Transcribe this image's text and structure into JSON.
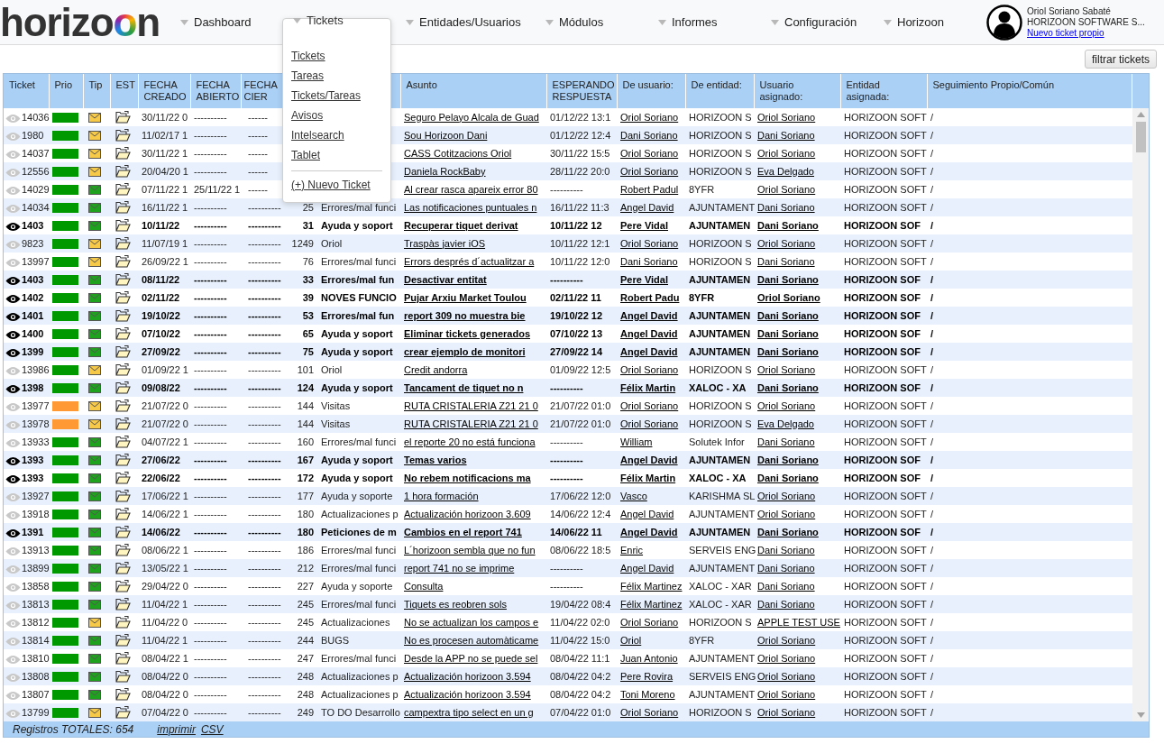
{
  "logo": {
    "text": "horizoon"
  },
  "nav": [
    {
      "label": "Dashboard",
      "expanded": false
    },
    {
      "label": "Tickets",
      "expanded": true
    },
    {
      "label": "Entidades/Usuarios",
      "expanded": false
    },
    {
      "label": "Módulos",
      "expanded": false
    },
    {
      "label": "Informes",
      "expanded": false
    },
    {
      "label": "Configuración",
      "expanded": false
    },
    {
      "label": "Horizoon",
      "expanded": false
    }
  ],
  "dropdown": {
    "items": [
      "Tickets",
      "Tareas",
      "Tickets/Tareas",
      "Avisos",
      "Intelsearch",
      "Tablet"
    ],
    "action": "(+) Nuevo Ticket"
  },
  "user": {
    "name": "Oriol Soriano Sabaté",
    "company": "HORIZOON SOFTWARE S...",
    "link": "Nuevo ticket propio"
  },
  "filter_button": "filtrar tickets",
  "table": {
    "columns": [
      "Ticket",
      "Prio",
      "Tip",
      "EST",
      "FECHA\nCREADO",
      "FECHA\nABIERTO",
      "FECHA\nCIER",
      "Asunto",
      "ESPERANDO\nRESPUESTA",
      "De usuario:",
      "De entidad:",
      "Usuario\nasignado:",
      "Entidad\nasignada:",
      "Seguimiento Propio/Común"
    ],
    "rows": [
      {
        "ticket": "14036",
        "unread": false,
        "priority": {
          "color": "#009900"
        },
        "type": {
          "color": "#f7c948"
        },
        "created": "30/11/22 0",
        "opened": "----------",
        "closed": "------",
        "subject": "Seguro Pelayo Alcala de Guad",
        "waiting": "01/12/22 13:1",
        "user": "Oriol Soriano",
        "entity": "HORIZOON S",
        "assigned_user": "Oriol Soriano",
        "assigned_entity": "HORIZOON SOFT",
        "follow": "/"
      },
      {
        "ticket": "1980",
        "unread": false,
        "priority": {
          "color": "#009900"
        },
        "type": {
          "color": "#f7c948"
        },
        "created": "11/02/17 1",
        "opened": "----------",
        "closed": "------",
        "subject": "Sou Horizoon Dani",
        "waiting": "01/12/22 12:4",
        "user": "Dani Soriano",
        "entity": "HORIZOON S",
        "assigned_user": "Dani Soriano",
        "assigned_entity": "HORIZOON SOFT",
        "follow": "/"
      },
      {
        "ticket": "14037",
        "unread": false,
        "priority": {
          "color": "#009900"
        },
        "type": {
          "color": "#f7c948"
        },
        "created": "30/11/22 1",
        "opened": "----------",
        "closed": "------",
        "subject": "CASS Cotitzacions Oriol",
        "waiting": "30/11/22 15:5",
        "user": "Oriol Soriano",
        "entity": "HORIZOON S",
        "assigned_user": "Oriol Soriano",
        "assigned_entity": "HORIZOON SOFT",
        "follow": "/"
      },
      {
        "ticket": "12556",
        "unread": false,
        "priority": {
          "color": "#009900"
        },
        "type": {
          "color": "#f7c948"
        },
        "created": "20/04/20 1",
        "opened": "----------",
        "closed": "------",
        "subject": "Daniela RockBaby",
        "waiting": "28/11/22 20:0",
        "user": "Oriol Soriano",
        "entity": "HORIZOON S",
        "assigned_user": "Eva Delgado",
        "assigned_entity": "HORIZOON SOFT",
        "follow": "/"
      },
      {
        "ticket": "14029",
        "unread": false,
        "priority": {
          "color": "#009900"
        },
        "type": {
          "color": "#1fa31f"
        },
        "created": "07/11/22 1",
        "opened": "25/11/22 1",
        "closed": "------",
        "subject": "Al crear rasca apareix error 80",
        "waiting": "----------",
        "user": "Robert Padul",
        "entity": "8YFR",
        "assigned_user": "Oriol Soriano",
        "assigned_entity": "HORIZOON SOFT",
        "follow": "/"
      },
      {
        "ticket": "14034",
        "unread": false,
        "priority": {
          "color": "#009900"
        },
        "type": {
          "color": "#1fa31f"
        },
        "created": "16/11/22 1",
        "opened": "----------",
        "closed": "----------",
        "d": "25",
        "category": "Errores/mal funci",
        "subject": "Las notificaciones puntuales n",
        "waiting": "16/11/22 11:3",
        "user": "Angel David",
        "entity": "AJUNTAMENT",
        "assigned_user": "Dani Soriano",
        "assigned_entity": "HORIZOON SOFT",
        "follow": "/"
      },
      {
        "ticket": "1403",
        "unread": true,
        "priority": {
          "color": "#009900"
        },
        "type": {
          "color": "#1fa31f"
        },
        "created": "10/11/22",
        "opened": "----------",
        "closed": "----------",
        "d": "31",
        "category": "Ayuda y soport",
        "subject": "Recuperar tiquet derivat",
        "waiting": "10/11/22 12",
        "user": "Pere Vidal",
        "entity": "AJUNTAMEN",
        "assigned_user": "Dani Soriano",
        "assigned_entity": "HORIZOON SOF",
        "follow": "/"
      },
      {
        "ticket": "9823",
        "unread": false,
        "priority": {
          "color": "#009900"
        },
        "type": {
          "color": "#f7c948"
        },
        "created": "11/07/19 1",
        "opened": "----------",
        "closed": "----------",
        "d": "1249",
        "category": "Oriol",
        "subject": "Traspàs javier iOS",
        "waiting": "10/11/22 12:1",
        "user": "Oriol Soriano",
        "entity": "HORIZOON S",
        "assigned_user": "Oriol Soriano",
        "assigned_entity": "HORIZOON SOFT",
        "follow": "/"
      },
      {
        "ticket": "13997",
        "unread": false,
        "priority": {
          "color": "#009900"
        },
        "type": {
          "color": "#f7c948"
        },
        "created": "26/09/22 1",
        "opened": "----------",
        "closed": "----------",
        "d": "76",
        "category": "Errores/mal funci",
        "subject": "Errors després d´actualitzar a",
        "waiting": "10/11/22 12:0",
        "user": "Dani Soriano",
        "entity": "HORIZOON S",
        "assigned_user": "Dani Soriano",
        "assigned_entity": "HORIZOON SOFT",
        "follow": "/"
      },
      {
        "ticket": "1403",
        "unread": true,
        "priority": {
          "color": "#009900"
        },
        "type": {
          "color": "#1fa31f"
        },
        "created": "08/11/22",
        "opened": "----------",
        "closed": "----------",
        "d": "33",
        "category": "Errores/mal fun",
        "subject": "Desactivar entitat",
        "waiting": "----------",
        "user": "Pere Vidal",
        "entity": "AJUNTAMEN",
        "assigned_user": "Dani Soriano",
        "assigned_entity": "HORIZOON SOF",
        "follow": "/"
      },
      {
        "ticket": "1402",
        "unread": true,
        "priority": {
          "color": "#009900"
        },
        "type": {
          "color": "#1fa31f"
        },
        "created": "02/11/22",
        "opened": "----------",
        "closed": "----------",
        "d": "39",
        "category": "NOVES FUNCIO",
        "subject": "Pujar Arxiu Market Toulou",
        "waiting": "02/11/22 11",
        "user": "Robert Padu",
        "entity": "8YFR",
        "assigned_user": "Oriol Soriano",
        "assigned_entity": "HORIZOON SOF",
        "follow": "/"
      },
      {
        "ticket": "1401",
        "unread": true,
        "priority": {
          "color": "#009900"
        },
        "type": {
          "color": "#1fa31f"
        },
        "created": "19/10/22",
        "opened": "----------",
        "closed": "----------",
        "d": "53",
        "category": "Errores/mal fun",
        "subject": "report 309 no muestra bie",
        "waiting": "19/10/22 12",
        "user": "Angel David",
        "entity": "AJUNTAMEN",
        "assigned_user": "Dani Soriano",
        "assigned_entity": "HORIZOON SOF",
        "follow": "/"
      },
      {
        "ticket": "1400",
        "unread": true,
        "priority": {
          "color": "#009900"
        },
        "type": {
          "color": "#1fa31f"
        },
        "created": "07/10/22",
        "opened": "----------",
        "closed": "----------",
        "d": "65",
        "category": "Ayuda y soport",
        "subject": "Eliminar tickets generados",
        "waiting": "07/10/22 13",
        "user": "Angel David",
        "entity": "AJUNTAMEN",
        "assigned_user": "Dani Soriano",
        "assigned_entity": "HORIZOON SOF",
        "follow": "/"
      },
      {
        "ticket": "1399",
        "unread": true,
        "priority": {
          "color": "#009900"
        },
        "type": {
          "color": "#1fa31f"
        },
        "created": "27/09/22",
        "opened": "----------",
        "closed": "----------",
        "d": "75",
        "category": "Ayuda y soport",
        "subject": "crear ejemplo de monitori",
        "waiting": "27/09/22 14",
        "user": "Angel David",
        "entity": "AJUNTAMEN",
        "assigned_user": "Dani Soriano",
        "assigned_entity": "HORIZOON SOF",
        "follow": "/"
      },
      {
        "ticket": "13986",
        "unread": false,
        "priority": {
          "color": "#009900"
        },
        "type": {
          "color": "#f7c948"
        },
        "created": "01/09/22 1",
        "opened": "----------",
        "closed": "----------",
        "d": "101",
        "category": "Oriol",
        "subject": "Credit andorra",
        "waiting": "01/09/22 12:5",
        "user": "Oriol Soriano",
        "entity": "HORIZOON S",
        "assigned_user": "Oriol Soriano",
        "assigned_entity": "HORIZOON SOFT",
        "follow": "/"
      },
      {
        "ticket": "1398",
        "unread": true,
        "priority": {
          "color": "#009900"
        },
        "type": {
          "color": "#1fa31f"
        },
        "created": "09/08/22",
        "opened": "----------",
        "closed": "----------",
        "d": "124",
        "category": "Ayuda y soport",
        "subject": "Tancament de tiquet no n",
        "waiting": "----------",
        "user": "Félix Martin",
        "entity": "XALOC - XA",
        "assigned_user": "Dani Soriano",
        "assigned_entity": "HORIZOON SOF",
        "follow": "/"
      },
      {
        "ticket": "13977",
        "unread": false,
        "priority": {
          "color": "#ff9933"
        },
        "type": {
          "color": "#f7c948"
        },
        "created": "21/07/22 0",
        "opened": "----------",
        "closed": "----------",
        "d": "144",
        "category": "Visitas",
        "subject": "RUTA CRISTALERIA Z21 21 0",
        "waiting": "21/07/22 01:0",
        "user": "Oriol Soriano",
        "entity": "HORIZOON S",
        "assigned_user": "Oriol Soriano",
        "assigned_entity": "HORIZOON SOFT",
        "follow": "/"
      },
      {
        "ticket": "13978",
        "unread": false,
        "priority": {
          "color": "#ff9933"
        },
        "type": {
          "color": "#f7c948"
        },
        "created": "21/07/22 0",
        "opened": "----------",
        "closed": "----------",
        "d": "144",
        "category": "Visitas",
        "subject": "RUTA CRISTALERIA Z21 21 0",
        "waiting": "21/07/22 01:0",
        "user": "Oriol Soriano",
        "entity": "HORIZOON S",
        "assigned_user": "Eva Delgado",
        "assigned_entity": "HORIZOON SOFT",
        "follow": "/"
      },
      {
        "ticket": "13933",
        "unread": false,
        "priority": {
          "color": "#009900"
        },
        "type": {
          "color": "#1fa31f"
        },
        "created": "04/07/22 1",
        "opened": "----------",
        "closed": "----------",
        "d": "160",
        "category": "Errores/mal funci",
        "subject": "el reporte 20 no está funciona",
        "waiting": "----------",
        "user": "William",
        "entity": "Solutek Infor",
        "assigned_user": "Dani Soriano",
        "assigned_entity": "HORIZOON SOFT",
        "follow": "/"
      },
      {
        "ticket": "1393",
        "unread": true,
        "priority": {
          "color": "#009900"
        },
        "type": {
          "color": "#1fa31f"
        },
        "created": "27/06/22",
        "opened": "----------",
        "closed": "----------",
        "d": "167",
        "category": "Ayuda y soport",
        "subject": "Temas varios",
        "waiting": "----------",
        "user": "Angel David",
        "entity": "AJUNTAMEN",
        "assigned_user": "Dani Soriano",
        "assigned_entity": "HORIZOON SOF",
        "follow": "/"
      },
      {
        "ticket": "1393",
        "unread": true,
        "priority": {
          "color": "#009900"
        },
        "type": {
          "color": "#1fa31f"
        },
        "created": "22/06/22",
        "opened": "----------",
        "closed": "----------",
        "d": "172",
        "category": "Ayuda y soport",
        "subject": "No rebem notificacions ma",
        "waiting": "----------",
        "user": "Félix Martin",
        "entity": "XALOC - XA",
        "assigned_user": "Dani Soriano",
        "assigned_entity": "HORIZOON SOF",
        "follow": "/"
      },
      {
        "ticket": "13927",
        "unread": false,
        "priority": {
          "color": "#009900"
        },
        "type": {
          "color": "#1fa31f"
        },
        "created": "17/06/22 1",
        "opened": "----------",
        "closed": "----------",
        "d": "177",
        "category": "Ayuda y soporte",
        "subject": "1 hora formación",
        "waiting": "17/06/22 12:0",
        "user": "Vasco",
        "entity": "KARISHMA SL",
        "assigned_user": "Oriol Soriano",
        "assigned_entity": "HORIZOON SOFT",
        "follow": "/"
      },
      {
        "ticket": "13918",
        "unread": false,
        "priority": {
          "color": "#009900"
        },
        "type": {
          "color": "#1fa31f"
        },
        "created": "14/06/22 1",
        "opened": "----------",
        "closed": "----------",
        "d": "180",
        "category": "Actualizaciones p",
        "subject": "Actualización horizoon 3.609",
        "waiting": "14/06/22 12:4",
        "user": "Angel David",
        "entity": "AJUNTAMENT",
        "assigned_user": "Oriol Soriano",
        "assigned_entity": "HORIZOON SOFT",
        "follow": "/"
      },
      {
        "ticket": "1391",
        "unread": true,
        "priority": {
          "color": "#009900"
        },
        "type": {
          "color": "#1fa31f"
        },
        "created": "14/06/22",
        "opened": "----------",
        "closed": "----------",
        "d": "180",
        "category": "Peticiones de m",
        "subject": "Cambios en el report 741",
        "waiting": "14/06/22 11",
        "user": "Angel David",
        "entity": "AJUNTAMEN",
        "assigned_user": "Dani Soriano",
        "assigned_entity": "HORIZOON SOF",
        "follow": "/"
      },
      {
        "ticket": "13913",
        "unread": false,
        "priority": {
          "color": "#009900"
        },
        "type": {
          "color": "#1fa31f"
        },
        "created": "08/06/22 1",
        "opened": "----------",
        "closed": "----------",
        "d": "186",
        "category": "Errores/mal funci",
        "subject": "L´horizoon sembla que no fun",
        "waiting": "08/06/22 18:5",
        "user": "Enric",
        "entity": "SERVEIS ENG",
        "assigned_user": "Dani Soriano",
        "assigned_entity": "HORIZOON SOFT",
        "follow": "/"
      },
      {
        "ticket": "13899",
        "unread": false,
        "priority": {
          "color": "#009900"
        },
        "type": {
          "color": "#1fa31f"
        },
        "created": "13/05/22 1",
        "opened": "----------",
        "closed": "----------",
        "d": "212",
        "category": "Errores/mal funci",
        "subject": "report 741 no se imprime",
        "waiting": "----------",
        "user": "Angel David",
        "entity": "AJUNTAMENT",
        "assigned_user": "Dani Soriano",
        "assigned_entity": "HORIZOON SOFT",
        "follow": "/"
      },
      {
        "ticket": "13858",
        "unread": false,
        "priority": {
          "color": "#009900"
        },
        "type": {
          "color": "#1fa31f"
        },
        "created": "29/04/22 0",
        "opened": "----------",
        "closed": "----------",
        "d": "227",
        "category": "Ayuda y soporte",
        "subject": "Consulta",
        "waiting": "----------",
        "user": "Félix Martinez",
        "entity": "XALOC - XAR",
        "assigned_user": "Dani Soriano",
        "assigned_entity": "HORIZOON SOFT",
        "follow": "/"
      },
      {
        "ticket": "13813",
        "unread": false,
        "priority": {
          "color": "#009900"
        },
        "type": {
          "color": "#1fa31f"
        },
        "created": "11/04/22 1",
        "opened": "----------",
        "closed": "----------",
        "d": "245",
        "category": "Errores/mal funci",
        "subject": "Tiquets es reobren sols",
        "waiting": "19/04/22 08:4",
        "user": "Félix Martinez",
        "entity": "XALOC - XAR",
        "assigned_user": "Dani Soriano",
        "assigned_entity": "HORIZOON SOFT",
        "follow": "/"
      },
      {
        "ticket": "13812",
        "unread": false,
        "priority": {
          "color": "#009900"
        },
        "type": {
          "color": "#f7c948"
        },
        "created": "11/04/22 0",
        "opened": "----------",
        "closed": "----------",
        "d": "245",
        "category": "Actualizaciones",
        "subject": "No se actualizan los campos e",
        "waiting": "11/04/22 02:0",
        "user": "Oriol Soriano",
        "entity": "HORIZOON S",
        "assigned_user": "APPLE TEST USE",
        "assigned_entity": "HORIZOON SOFT",
        "follow": "/"
      },
      {
        "ticket": "13814",
        "unread": false,
        "priority": {
          "color": "#009900"
        },
        "type": {
          "color": "#1fa31f"
        },
        "created": "11/04/22 1",
        "opened": "----------",
        "closed": "----------",
        "d": "244",
        "category": "BUGS",
        "subject": "No es procesen automàticame",
        "waiting": "11/04/22 15:0",
        "user": "Oriol",
        "entity": "8YFR",
        "assigned_user": "Oriol Soriano",
        "assigned_entity": "HORIZOON SOFT",
        "follow": "/"
      },
      {
        "ticket": "13810",
        "unread": false,
        "priority": {
          "color": "#009900"
        },
        "type": {
          "color": "#1fa31f"
        },
        "created": "08/04/22 1",
        "opened": "----------",
        "closed": "----------",
        "d": "247",
        "category": "Errores/mal funci",
        "subject": "Desde la APP no se puede sel",
        "waiting": "08/04/22 11:1",
        "user": "Juan Antonio",
        "entity": "AJUNTAMENT",
        "assigned_user": "Oriol Soriano",
        "assigned_entity": "HORIZOON SOFT",
        "follow": "/"
      },
      {
        "ticket": "13808",
        "unread": false,
        "priority": {
          "color": "#009900"
        },
        "type": {
          "color": "#1fa31f"
        },
        "created": "08/04/22 0",
        "opened": "----------",
        "closed": "----------",
        "d": "248",
        "category": "Actualizaciones p",
        "subject": "Actualización horizoon 3.594",
        "waiting": "08/04/22 04:2",
        "user": "Pere Rovira",
        "entity": "SERVEIS ENG",
        "assigned_user": "Oriol Soriano",
        "assigned_entity": "HORIZOON SOFT",
        "follow": "/"
      },
      {
        "ticket": "13807",
        "unread": false,
        "priority": {
          "color": "#009900"
        },
        "type": {
          "color": "#1fa31f"
        },
        "created": "08/04/22 0",
        "opened": "----------",
        "closed": "----------",
        "d": "248",
        "category": "Actualizaciones p",
        "subject": "Actualización horizoon 3.594",
        "waiting": "08/04/22 04:2",
        "user": "Toni Moreno",
        "entity": "AJUNTAMENT",
        "assigned_user": "Oriol Soriano",
        "assigned_entity": "HORIZOON SOFT",
        "follow": "/"
      },
      {
        "ticket": "13799",
        "unread": false,
        "priority": {
          "color": "#009900"
        },
        "type": {
          "color": "#f7c948"
        },
        "created": "07/04/22 0",
        "opened": "----------",
        "closed": "----------",
        "d": "249",
        "category": "TO DO Desarrollo",
        "subject": "campextra tipo select en un g",
        "waiting": "07/04/22 01:0",
        "user": "Oriol Soriano",
        "entity": "HORIZOON S",
        "assigned_user": "Oriol Soriano",
        "assigned_entity": "HORIZOON SOFT",
        "follow": "/"
      }
    ]
  },
  "footer": {
    "total": "Registros TOTALES: 654",
    "links": [
      "imprimir",
      "CSV"
    ]
  }
}
